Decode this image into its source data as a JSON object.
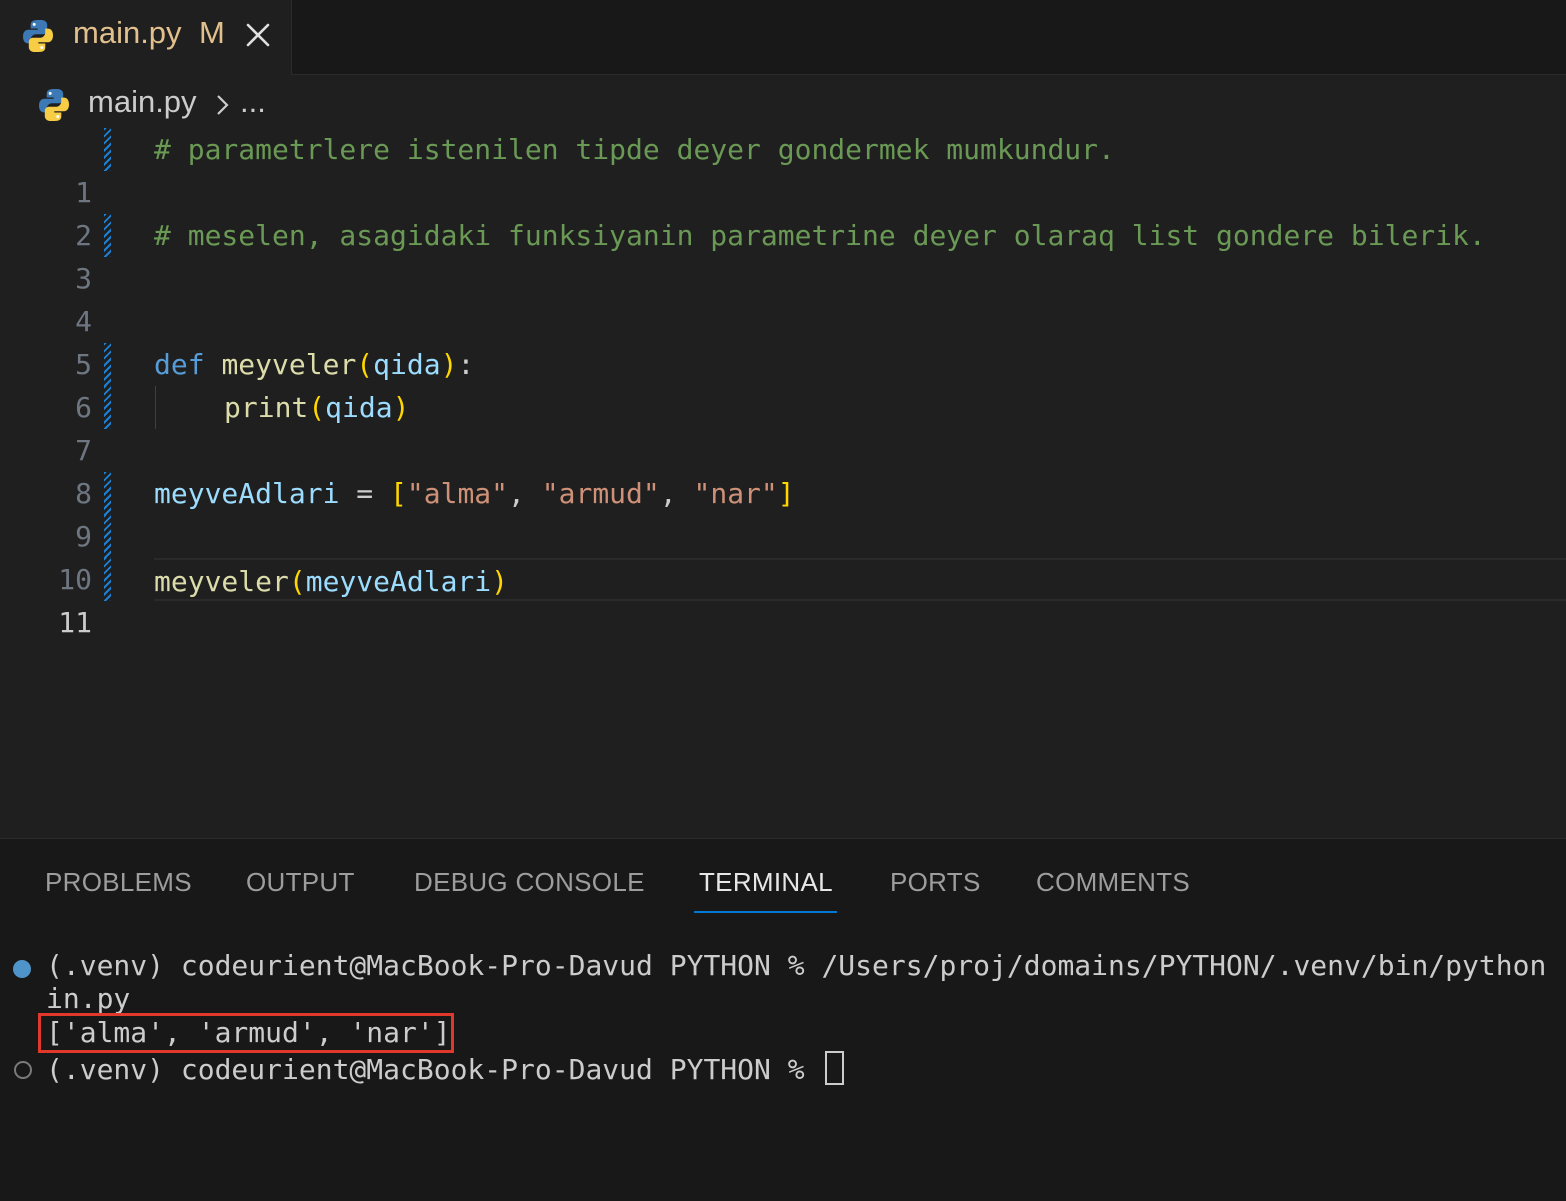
{
  "tab": {
    "label": "main.py",
    "status": "M"
  },
  "breadcrumb": {
    "file": "main.py",
    "more": "..."
  },
  "editor": {
    "lines": [
      {
        "num": "1",
        "comment": "# parametrlere istenilen tipde deyer gondermek mumkundur."
      },
      {
        "num": "2"
      },
      {
        "num": "3",
        "comment": "# meselen, asagidaki funksiyanin parametrine deyer olaraq list gondere bilerik."
      },
      {
        "num": "4"
      },
      {
        "num": "5"
      },
      {
        "num": "6",
        "kw": "def",
        "fname": "meyveler",
        "open": "(",
        "param": "qida",
        "close": ")",
        "colon": ":"
      },
      {
        "num": "7",
        "fname": "print",
        "open": "(",
        "param": "qida",
        "close": ")"
      },
      {
        "num": "8"
      },
      {
        "num": "9",
        "var": "meyveAdlari",
        "op": " = ",
        "open": "[",
        "s1": "\"alma\"",
        "c1": ", ",
        "s2": "\"armud\"",
        "c2": ", ",
        "s3": "\"nar\"",
        "close": "]"
      },
      {
        "num": "10"
      },
      {
        "num": "11",
        "fname": "meyveler",
        "open": "(",
        "param": "meyveAdlari",
        "close": ")"
      }
    ]
  },
  "panel": {
    "tabs": [
      "PROBLEMS",
      "OUTPUT",
      "DEBUG CONSOLE",
      "TERMINAL",
      "PORTS",
      "COMMENTS"
    ],
    "active_tab": "TERMINAL"
  },
  "terminal": {
    "line1": "(.venv) codeurient@MacBook-Pro-Davud PYTHON % /Users/proj/domains/PYTHON/.venv/bin/python",
    "line2": "in.py",
    "output": "['alma', 'armud', 'nar']",
    "prompt": "(.venv) codeurient@MacBook-Pro-Davud PYTHON % "
  },
  "colors": {
    "modified": "#e2c08d",
    "comment": "#6a9955",
    "keyword": "#569cd6",
    "function": "#dcdcaa",
    "variable": "#9cdcfe",
    "string": "#ce9178",
    "highlight_box": "#e0392b",
    "active_tab_underline": "#0078d4"
  }
}
